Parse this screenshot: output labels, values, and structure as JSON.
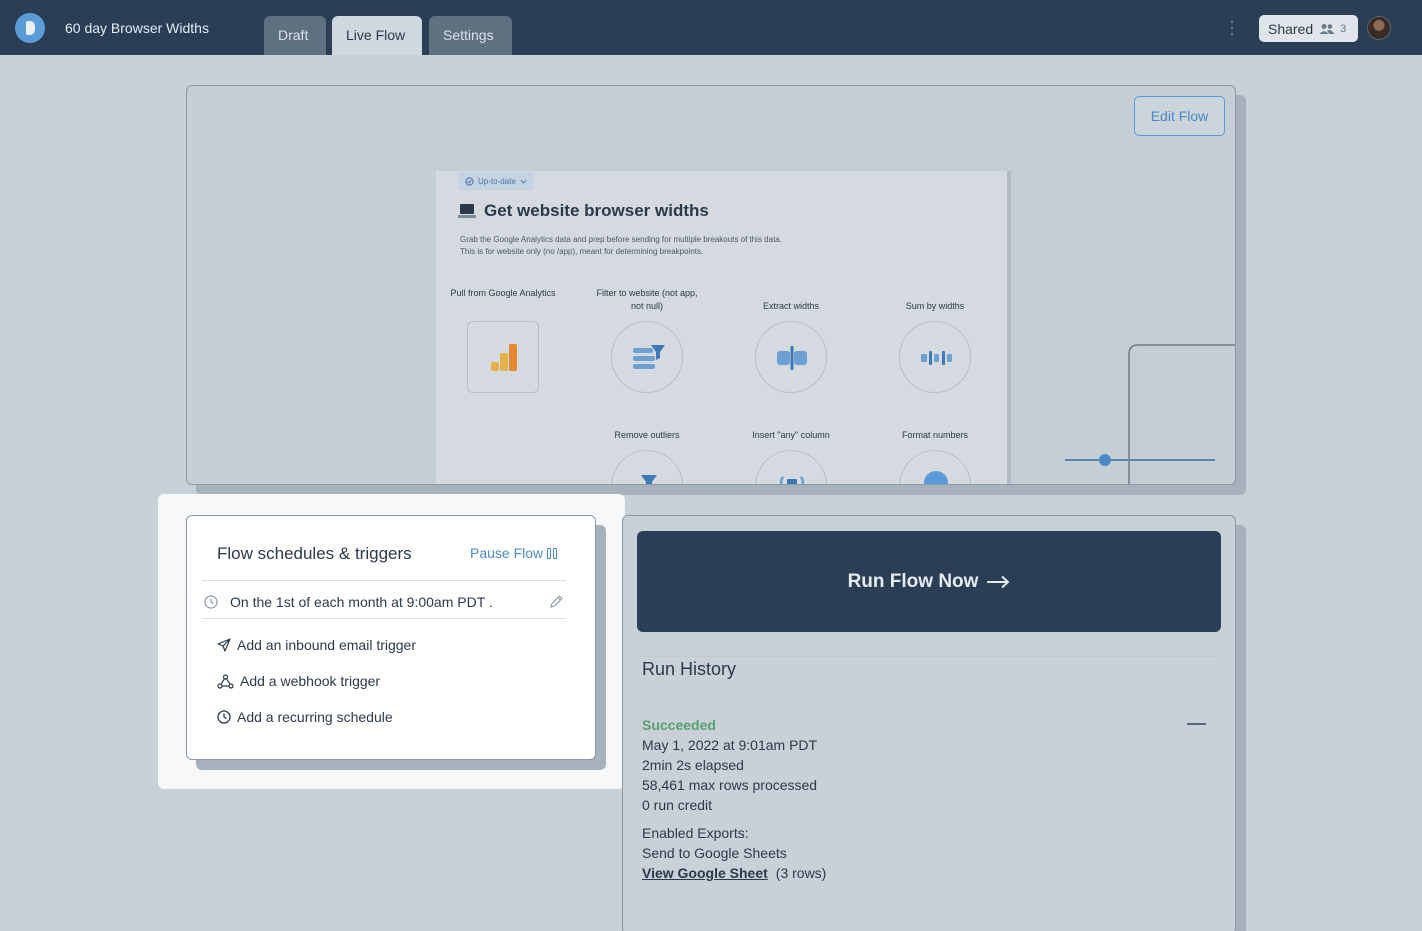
{
  "app": {
    "title": "60 day Browser Widths"
  },
  "tabs": [
    {
      "label": "Draft",
      "active": false
    },
    {
      "label": "Live Flow",
      "active": true
    },
    {
      "label": "Settings",
      "active": false
    }
  ],
  "header": {
    "shared_label": "Shared",
    "shared_count": "3"
  },
  "preview": {
    "edit_flow_label": "Edit Flow",
    "status_pill": "Up-to-date",
    "flow_title": "Get website browser widths",
    "flow_description": "Grab the Google Analytics data and prep before sending for multiple breakouts of this data. This is for website only (no /app), meant for determining breakpoints.",
    "steps_row1": [
      {
        "label": "Pull from Google Analytics"
      },
      {
        "label": "Filter to website (not app, not null)"
      },
      {
        "label": "Extract widths"
      },
      {
        "label": "Sum by widths"
      }
    ],
    "steps_row2": [
      {
        "label": "Remove outliers"
      },
      {
        "label": "Insert \"any\" column"
      },
      {
        "label": "Format numbers"
      }
    ]
  },
  "triggers": {
    "title": "Flow schedules & triggers",
    "pause_label": "Pause Flow",
    "schedule_text": "On the 1st of each month at  9:00am PDT .",
    "add_items": [
      {
        "label": "Add an inbound email trigger",
        "icon": "send-icon"
      },
      {
        "label": "Add a webhook trigger",
        "icon": "webhook-icon"
      },
      {
        "label": "Add a recurring schedule",
        "icon": "clock-icon"
      }
    ]
  },
  "run": {
    "button_label": "Run Flow Now",
    "history_title": "Run History",
    "entry": {
      "status": "Succeeded",
      "date": "May 1, 2022 at 9:01am PDT",
      "elapsed": "2min 2s elapsed",
      "rows": "58,461 max rows processed",
      "credit": "0 run credit"
    },
    "exports_label": "Enabled Exports:",
    "export_destination": "Send to Google Sheets",
    "sheet_link": "View Google Sheet",
    "sheet_rows": "(3 rows)"
  },
  "colors": {
    "topbar": "#2a3f55",
    "accent": "#4b89c5",
    "success": "#5a9e74"
  }
}
